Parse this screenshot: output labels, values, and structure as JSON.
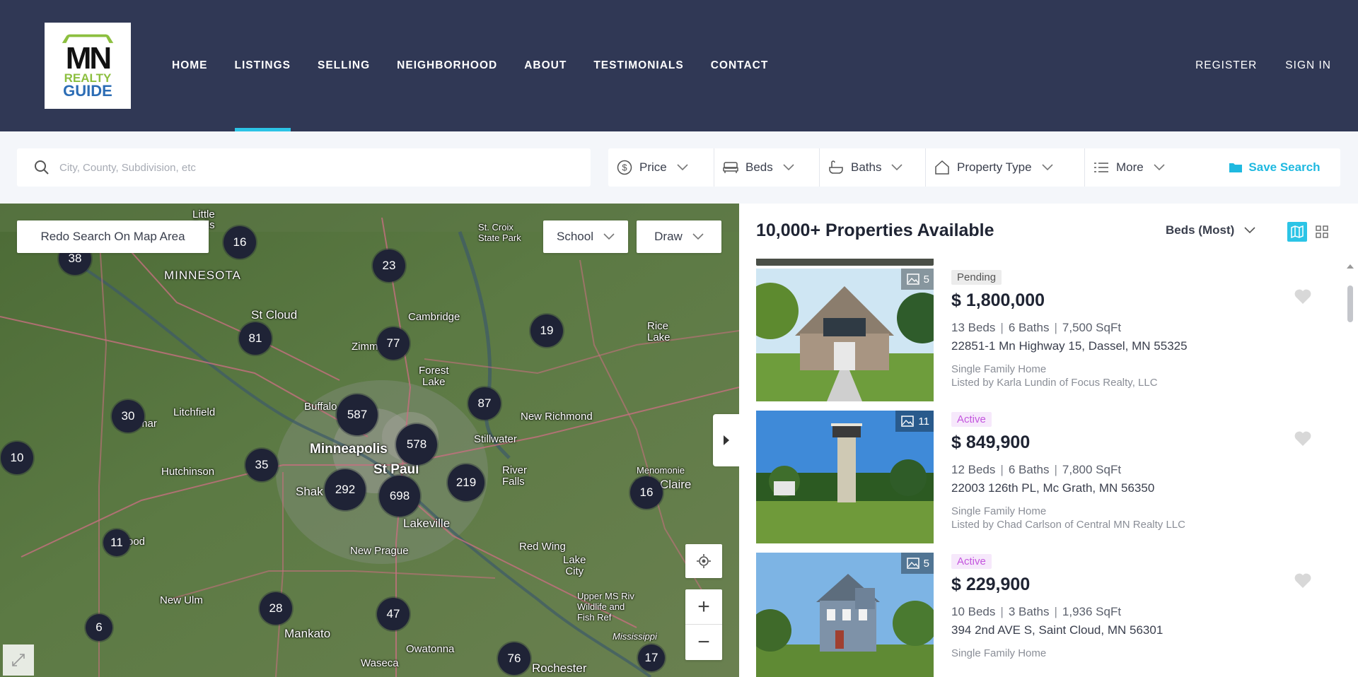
{
  "logo": {
    "line1": "MN",
    "line2": "REALTY",
    "line3": "GUIDE"
  },
  "nav": {
    "items": [
      {
        "label": "HOME"
      },
      {
        "label": "LISTINGS"
      },
      {
        "label": "SELLING"
      },
      {
        "label": "NEIGHBORHOOD"
      },
      {
        "label": "ABOUT"
      },
      {
        "label": "TESTIMONIALS"
      },
      {
        "label": "CONTACT"
      }
    ],
    "active": "LISTINGS"
  },
  "auth": {
    "register": "REGISTER",
    "sign_in": "SIGN IN"
  },
  "search": {
    "placeholder": "City, County, Subdivision, etc",
    "value": ""
  },
  "filters": {
    "price": "Price",
    "beds": "Beds",
    "baths": "Baths",
    "property_type": "Property Type",
    "more": "More"
  },
  "save_search": "Save Search",
  "map": {
    "redo_search": "Redo Search On Map Area",
    "school": "School",
    "draw": "Draw",
    "zoom_in": "+",
    "zoom_out": "−",
    "labels": {
      "little_falls": "Little\nFalls",
      "minnesota": "MINNESOTA",
      "st_cloud": "St Cloud",
      "zimmerman": "Zimm",
      "cambridge": "Cambridge",
      "st_croix": "St. Croix\nState Park",
      "rice_lake": "Rice\nLake",
      "forest_lake": "Forest\nLake",
      "buffalo": "Buffalo",
      "litchfield": "Litchfield",
      "new_richmond": "New Richmond",
      "stillwater": "Stillwater",
      "minneapolis": "Minneapolis",
      "st_paul": "St Paul",
      "hutchinson": "Hutchinson",
      "river_falls": "River\nFalls",
      "menomonie": "Menomonie",
      "eau_claire": "Eau Claire",
      "shakopee": "Shak",
      "lakeville": "Lakeville",
      "new_prague": "New Prague",
      "red_wing": "Red Wing",
      "lake_city": "Lake\nCity",
      "new_ulm": "New Ulm",
      "mankato": "Mankato",
      "owatonna": "Owatonna",
      "waseca": "Waseca",
      "rochester": "Rochester",
      "upper_miss": "Upper MS Riv\nWildlife and\nFish Ref",
      "mississippi": "Mississippi",
      "ood": "ood",
      "mar": "mar"
    },
    "clusters": [
      "38",
      "16",
      "23",
      "81",
      "77",
      "19",
      "30",
      "587",
      "87",
      "578",
      "10",
      "35",
      "292",
      "698",
      "219",
      "16",
      "11",
      "28",
      "47",
      "6",
      "76",
      "17"
    ]
  },
  "results": {
    "title": "10,000+ Properties Available",
    "sort": "Beds (Most)",
    "listings": [
      {
        "status": "Pending",
        "photos": "5",
        "price": "$ 1,800,000",
        "beds": "13 Beds",
        "baths": "6 Baths",
        "sqft": "7,500 SqFt",
        "address": "22851-1 Mn Highway 15, Dassel, MN 55325",
        "type": "Single Family Home",
        "listed_by": "Listed by Karla Lundin of Focus Realty, LLC"
      },
      {
        "status": "Active",
        "photos": "11",
        "price": "$ 849,900",
        "beds": "12 Beds",
        "baths": "6 Baths",
        "sqft": "7,800 SqFt",
        "address": "22003 126th PL, Mc Grath, MN 56350",
        "type": "Single Family Home",
        "listed_by": "Listed by Chad Carlson of Central MN Realty LLC"
      },
      {
        "status": "Active",
        "photos": "5",
        "price": "$ 229,900",
        "beds": "10 Beds",
        "baths": "3 Baths",
        "sqft": "1,936 SqFt",
        "address": "394 2nd AVE S, Saint Cloud, MN 56301",
        "type": "Single Family Home",
        "listed_by": ""
      }
    ]
  },
  "colors": {
    "header_bg": "#303855",
    "accent": "#2cc4e6",
    "cluster": "#1f2336",
    "active_badge": "#c456de"
  }
}
